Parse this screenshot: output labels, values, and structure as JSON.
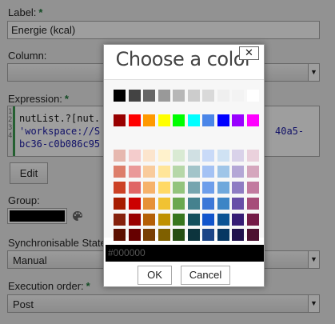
{
  "form": {
    "label_label": "Label:",
    "label_required": "*",
    "label_value": "Energie (kcal)",
    "column_label": "Column:",
    "expression_label": "Expression:",
    "expression_required": "*",
    "code_lines": [
      "nutList.?[nut.",
      "'workspace://S",
      "bc36-c0b086c95"
    ],
    "code_lines_right": [
      "40a5-"
    ],
    "gutter": [
      "1",
      "2",
      "3",
      "4"
    ],
    "edit_button": "Edit",
    "group_label": "Group:",
    "group_color": "#000000",
    "palette_icon": "palette-icon",
    "sync_label": "Synchronisable State",
    "sync_value": "Manual",
    "exec_label": "Execution order:",
    "exec_required": "*",
    "exec_value": "Post"
  },
  "dialog": {
    "title": "Choose a color",
    "close_label": "✕",
    "hex_value": "#000000",
    "ok_label": "OK",
    "cancel_label": "Cancel",
    "rows": [
      [
        "#000000",
        "#434343",
        "#666666",
        "#999999",
        "#b7b7b7",
        "#cccccc",
        "#d9d9d9",
        "#efefef",
        "#f3f3f3",
        "#ffffff"
      ],
      [
        "#980000",
        "#ff0000",
        "#ff9900",
        "#ffff00",
        "#00ff00",
        "#00ffff",
        "#4a86e8",
        "#0000ff",
        "#9900ff",
        "#ff00ff"
      ],
      [
        "#e6b8af",
        "#f4cccc",
        "#fce5cd",
        "#fff2cc",
        "#d9ead3",
        "#d0e0e3",
        "#c9daf8",
        "#cfe2f3",
        "#d9d2e9",
        "#ead1dc"
      ],
      [
        "#dd7e6b",
        "#ea9999",
        "#f9cb9c",
        "#ffe599",
        "#b6d7a8",
        "#a2c4c9",
        "#a4c2f4",
        "#9fc5e8",
        "#b4a7d6",
        "#d5a6bd"
      ],
      [
        "#cc4125",
        "#e06666",
        "#f6b26b",
        "#ffd966",
        "#93c47d",
        "#76a5af",
        "#6d9eeb",
        "#6fa8dc",
        "#8e7cc3",
        "#c27ba0"
      ],
      [
        "#a61c00",
        "#cc0000",
        "#e69138",
        "#f1c232",
        "#6aa84f",
        "#45818e",
        "#3c78d8",
        "#3d85c6",
        "#674ea7",
        "#a64d79"
      ],
      [
        "#85200c",
        "#990000",
        "#b45f06",
        "#bf9000",
        "#38761d",
        "#134f5c",
        "#1155cc",
        "#0b5394",
        "#351c75",
        "#741b47"
      ],
      [
        "#5b0f00",
        "#660000",
        "#783f04",
        "#7f6000",
        "#274e13",
        "#0c343d",
        "#1c4587",
        "#073763",
        "#20124d",
        "#4c1130"
      ]
    ]
  }
}
